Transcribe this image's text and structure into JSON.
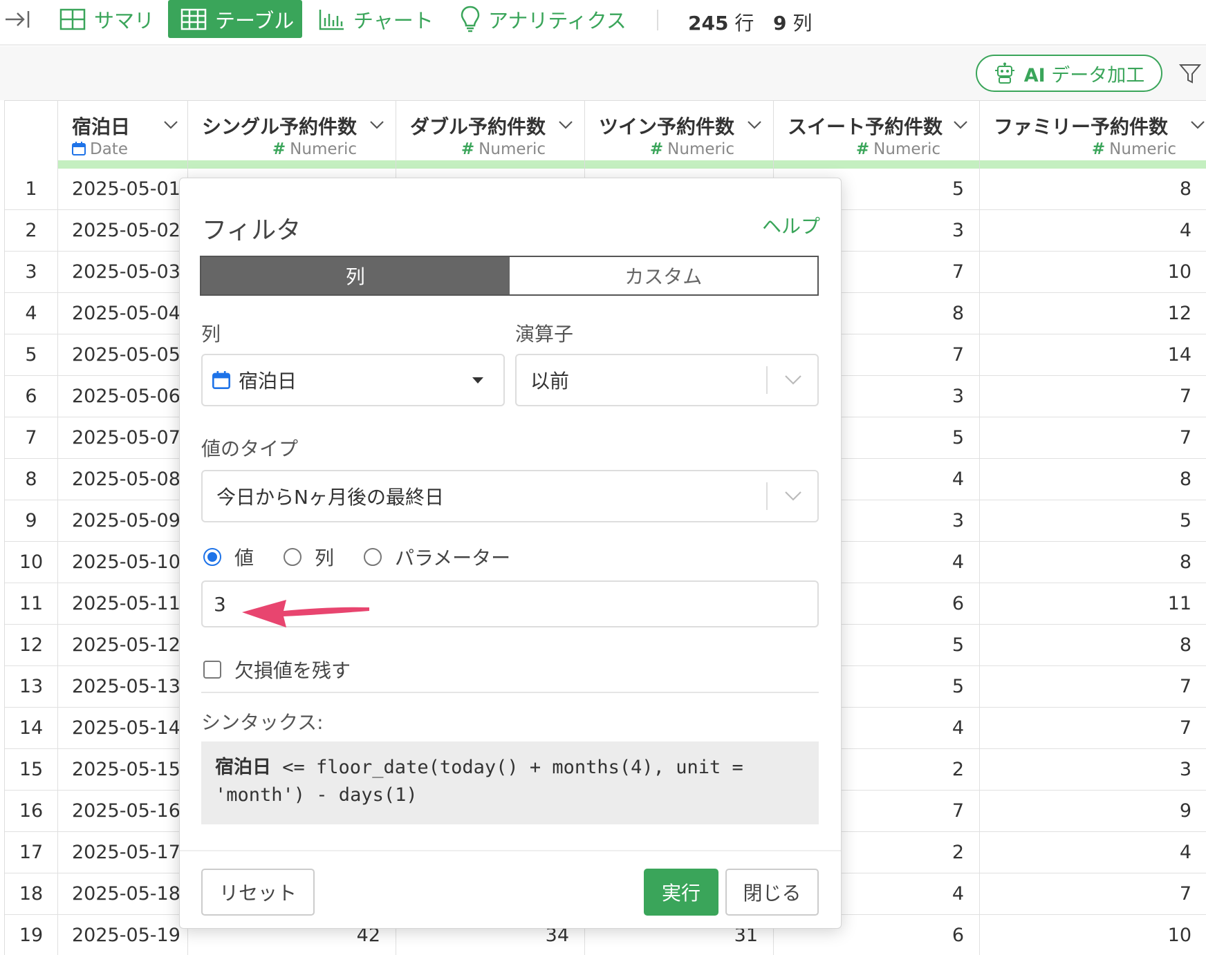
{
  "toolbar": {
    "tabs": [
      {
        "label": "サマリ",
        "icon": "summary-icon"
      },
      {
        "label": "テーブル",
        "icon": "table-icon"
      },
      {
        "label": "チャート",
        "icon": "chart-icon"
      },
      {
        "label": "アナリティクス",
        "icon": "lightbulb-icon"
      }
    ],
    "active_tab": "テーブル",
    "rows_count": "245",
    "rows_unit": "行",
    "cols_count": "9",
    "cols_unit": "列",
    "accent": "#3aa55a"
  },
  "subbar": {
    "ai_prefix": "AI",
    "ai_label": "データ加工"
  },
  "table": {
    "columns": [
      {
        "name": "宿泊日",
        "type": "Date"
      },
      {
        "name": "シングル予約件数",
        "type": "Numeric"
      },
      {
        "name": "ダブル予約件数",
        "type": "Numeric"
      },
      {
        "name": "ツイン予約件数",
        "type": "Numeric"
      },
      {
        "name": "スイート予約件数",
        "type": "Numeric"
      },
      {
        "name": "ファミリー予約件数",
        "type": "Numeric"
      }
    ],
    "rows": [
      {
        "idx": "1",
        "date": "2025-05-01",
        "suite": "5",
        "family": "8"
      },
      {
        "idx": "2",
        "date": "2025-05-02",
        "suite": "3",
        "family": "4"
      },
      {
        "idx": "3",
        "date": "2025-05-03",
        "suite": "7",
        "family": "10"
      },
      {
        "idx": "4",
        "date": "2025-05-04",
        "suite": "8",
        "family": "12"
      },
      {
        "idx": "5",
        "date": "2025-05-05",
        "suite": "7",
        "family": "14"
      },
      {
        "idx": "6",
        "date": "2025-05-06",
        "suite": "3",
        "family": "7"
      },
      {
        "idx": "7",
        "date": "2025-05-07",
        "suite": "5",
        "family": "7"
      },
      {
        "idx": "8",
        "date": "2025-05-08",
        "suite": "4",
        "family": "8"
      },
      {
        "idx": "9",
        "date": "2025-05-09",
        "suite": "3",
        "family": "5"
      },
      {
        "idx": "10",
        "date": "2025-05-10",
        "suite": "4",
        "family": "8"
      },
      {
        "idx": "11",
        "date": "2025-05-11",
        "suite": "6",
        "family": "11"
      },
      {
        "idx": "12",
        "date": "2025-05-12",
        "suite": "5",
        "family": "8"
      },
      {
        "idx": "13",
        "date": "2025-05-13",
        "suite": "5",
        "family": "7"
      },
      {
        "idx": "14",
        "date": "2025-05-14",
        "suite": "4",
        "family": "7"
      },
      {
        "idx": "15",
        "date": "2025-05-15",
        "suite": "2",
        "family": "3"
      },
      {
        "idx": "16",
        "date": "2025-05-16",
        "suite": "7",
        "family": "9"
      },
      {
        "idx": "17",
        "date": "2025-05-17",
        "suite": "2",
        "family": "4"
      },
      {
        "idx": "18",
        "date": "2025-05-18",
        "suite": "4",
        "family": "7"
      },
      {
        "idx": "19",
        "date": "2025-05-19",
        "single": "42",
        "double": "34",
        "twin": "31",
        "suite": "6",
        "family": "10"
      }
    ]
  },
  "dialog": {
    "title": "フィルタ",
    "help": "ヘルプ",
    "mode_tabs": [
      "列",
      "カスタム"
    ],
    "column_label": "列",
    "column_value": "宿泊日",
    "operator_label": "演算子",
    "operator_value": "以前",
    "value_type_label": "値のタイプ",
    "value_type_value": "今日からNヶ月後の最終日",
    "source_options": [
      "値",
      "列",
      "パラメーター"
    ],
    "selected_source": "値",
    "value_input": "3",
    "keep_missing_label": "欠損値を残す",
    "keep_missing_checked": false,
    "syntax_label": "シンタックス:",
    "syntax_column": "宿泊日",
    "syntax_code": " <= floor_date(today() + months(4), unit = 'month') - days(1)",
    "reset_label": "リセット",
    "run_label": "実行",
    "close_label": "閉じる"
  },
  "annotation": {
    "arrow_color": "#e8456f"
  }
}
